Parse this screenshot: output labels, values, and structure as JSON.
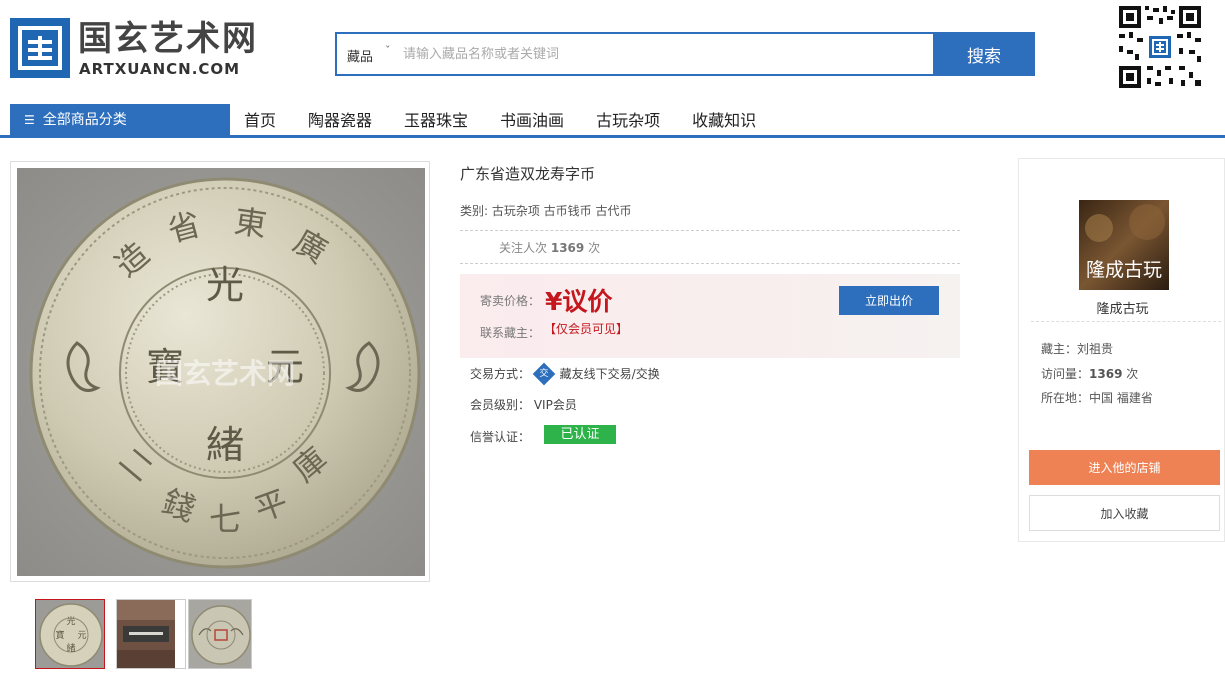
{
  "brand": {
    "name_cn": "国玄艺术网",
    "name_en": "ARTXUANCN.COM",
    "logo_char": "国"
  },
  "search": {
    "category": "藏品",
    "caret": "ˇ",
    "placeholder": "请输入藏品名称或者关键词",
    "button_label": "搜索"
  },
  "nav": {
    "all_categories": "全部商品分类",
    "items": [
      "首页",
      "陶器瓷器",
      "玉器珠宝",
      "书画油画",
      "古玩杂项",
      "收藏知识"
    ]
  },
  "product": {
    "title": "广东省造双龙寿字币",
    "category": "类别: 古玩杂项 古币钱币 古代币",
    "follow_label": "关注人次",
    "follow_count": "1369",
    "follow_unit": "次",
    "price_label": "寄卖价格：",
    "price_value": "¥议价",
    "contact_label": "联系藏主：",
    "contact_value": "【仅会员可见】",
    "bid_button": "立即出价",
    "trade_label": "交易方式：",
    "trade_icon_char": "交",
    "trade_value": "藏友线下交易/交换",
    "member_label": "会员级别：",
    "member_value": "VIP会员",
    "credit_label": "信誉认证：",
    "credit_value": "已认证",
    "watermark": "国玄艺术网",
    "coin_chars": {
      "top": "廣 東 省 造",
      "center_top": "光",
      "center_right": "元",
      "center_left": "寶",
      "center_bottom": "緒",
      "bottom": "庫平七錢二"
    }
  },
  "seller": {
    "avatar_text": "隆成古玩",
    "name": "隆成古玩",
    "owner_label": "藏主：",
    "owner": "刘祖贵",
    "visits_label": "访问量：",
    "visits": "1369",
    "visits_unit": "次",
    "location_label": "所在地：",
    "location": "中国 福建省",
    "shop_button": "进入他的店铺",
    "fav_button": "加入收藏"
  },
  "colors": {
    "primary": "#2d6fbd",
    "price_red": "#c4161c",
    "verified_green": "#2eb24a",
    "shop_orange": "#ee8255"
  }
}
